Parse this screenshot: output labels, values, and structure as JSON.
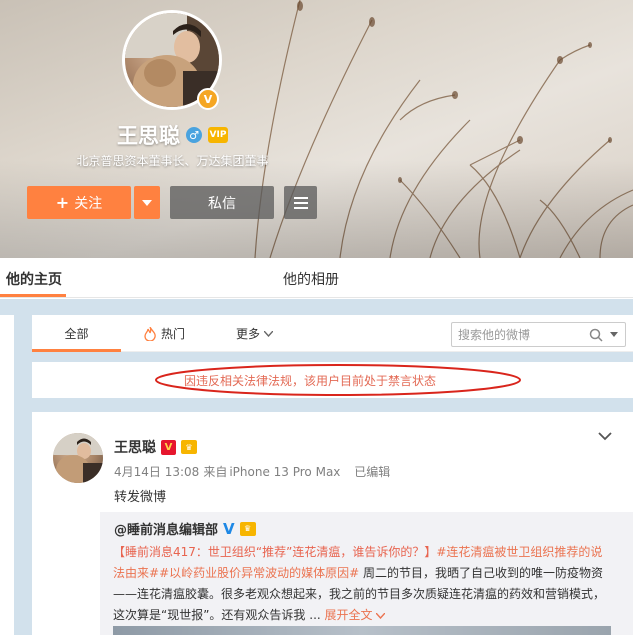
{
  "profile": {
    "name": "王思聪",
    "badge": "V",
    "vip": "VIP",
    "bio": "北京普思资本董事长、万达集团董事"
  },
  "actions": {
    "follow": "关注",
    "follow_plus": "+",
    "message": "私信"
  },
  "profile_tabs": [
    "他的主页",
    "他的相册"
  ],
  "feed_tabs": {
    "all": "全部",
    "hot": "热门",
    "more": "更多"
  },
  "search": {
    "placeholder": "搜索他的微博"
  },
  "notice": "因违反相关法律法规，该用户目前处于禁言状态",
  "post": {
    "author": "王思聪",
    "verified": "V",
    "date": "4月14日 13:08",
    "source_prefix": "来自",
    "source": "iPhone 13 Pro Max",
    "edited": "已编辑",
    "text": "转发微博",
    "repost": {
      "author": "@睡前消息编辑部",
      "verified": "V",
      "line1_prefix": "【睡前消息417：世卫组织“推荐”连花清瘟，谁告诉你的？】",
      "hashtag1": "#连花清瘟被世卫组织推荐的说法由来#",
      "hashtag2": "#以岭药业股价异常波动的媒体原因#",
      "body_rest": " 周二的节目，我晒了自己收到的唯一防疫物资——连花清瘟胶囊。很多老观众想起来，我之前的节目多次质疑连花清瘟的药效和营销模式，这次算是“现世报”。还有观众告诉我 ... ",
      "expand": "展开全文"
    }
  },
  "colors": {
    "accent": "#ff8140",
    "notice_red": "#e36a55",
    "link_orange": "#eb7350",
    "content_bg": "#d2e1ec"
  }
}
